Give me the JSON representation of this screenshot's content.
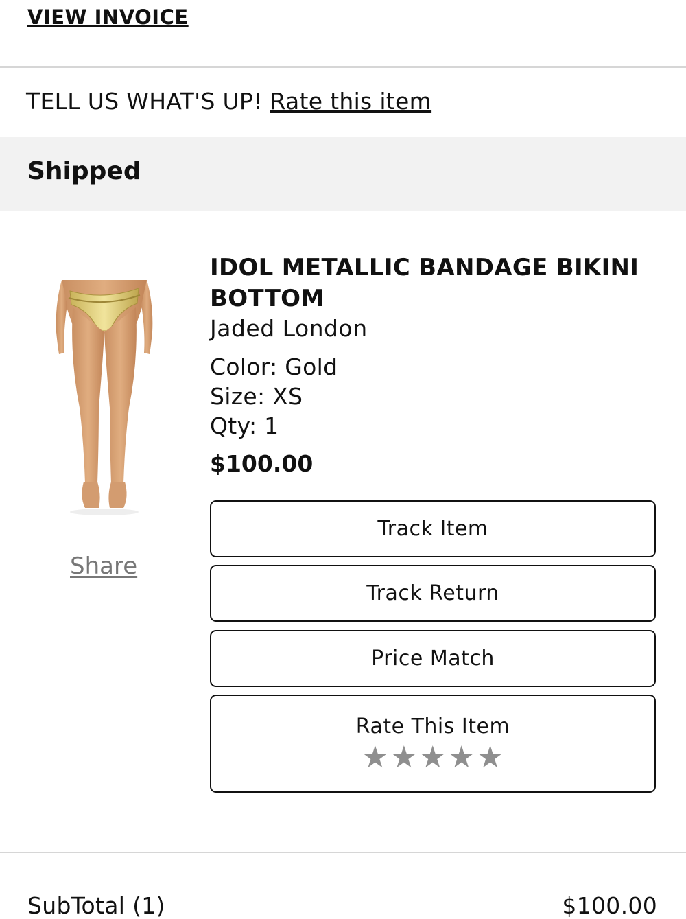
{
  "header": {
    "view_invoice": "VIEW INVOICE"
  },
  "feedback": {
    "prompt": "TELL US WHAT'S UP!",
    "link": "Rate this item"
  },
  "order_status": "Shipped",
  "product": {
    "name": "IDOL METALLIC BANDAGE BIKINI BOTTOM",
    "brand": "Jaded London",
    "color_line": "Color: Gold",
    "size_line": "Size: XS",
    "qty_line": "Qty: 1",
    "price": "$100.00",
    "share": "Share",
    "image_icon": "product-photo-bikini-bottom-gold"
  },
  "actions": {
    "track_item": "Track Item",
    "track_return": "Track Return",
    "price_match": "Price Match",
    "rate_item": "Rate This Item",
    "stars": [
      "★",
      "★",
      "★",
      "★",
      "★"
    ],
    "star_color": "#8f8f8f"
  },
  "summary": {
    "subtotal_label": "SubTotal (1)",
    "subtotal_value": "$100.00"
  }
}
